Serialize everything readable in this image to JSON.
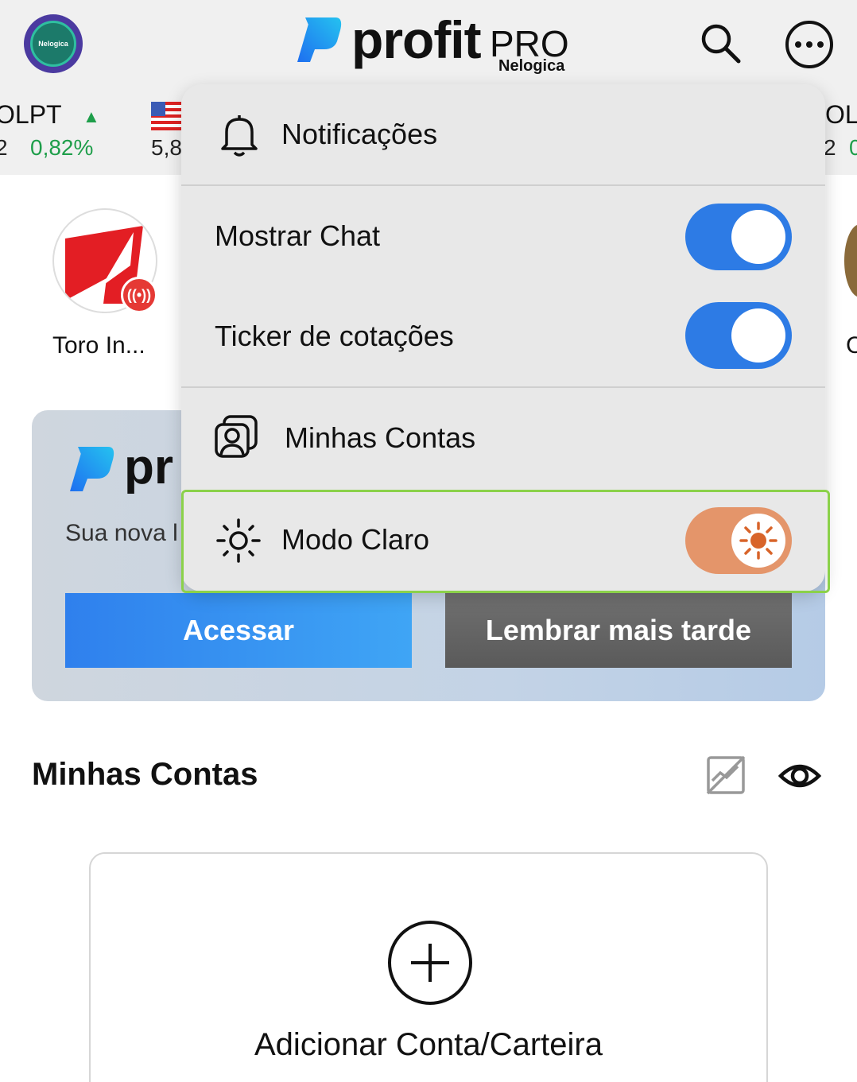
{
  "header": {
    "avatar_text": "Nelogica",
    "logo_word": "profit",
    "logo_pro": "PRO",
    "logo_sub": "Nelogica"
  },
  "ticker": {
    "left": {
      "name": "OLPT",
      "arrow": "▲",
      "price": "2",
      "change": "0,82%"
    },
    "middle": {
      "price": "5,8"
    },
    "right": {
      "name": "OL",
      "price": "2",
      "change": "0"
    }
  },
  "stories": {
    "first_label": "Toro In...",
    "right_label": "C"
  },
  "promo": {
    "logo_word": "pr",
    "text": "Sua nova l",
    "access_label": "Acessar",
    "later_label": "Lembrar mais tarde"
  },
  "accounts": {
    "title": "Minhas Contas",
    "add_label": "Adicionar Conta/Carteira"
  },
  "menu": {
    "notifications": "Notificações",
    "show_chat": {
      "label": "Mostrar Chat",
      "on": true
    },
    "ticker_quotes": {
      "label": "Ticker de cotações",
      "on": true
    },
    "my_accounts": "Minhas Contas",
    "light_mode": {
      "label": "Modo Claro",
      "on": true
    }
  },
  "colors": {
    "toggle_on": "#2d7be5",
    "toggle_light_mode": "#e4956a",
    "ticker_up": "#1e9e4a",
    "highlight": "#8bd14a"
  }
}
